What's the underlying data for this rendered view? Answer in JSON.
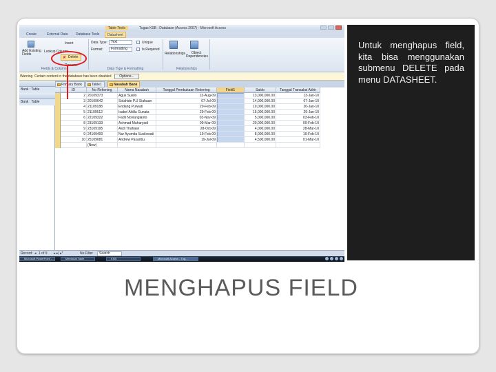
{
  "window": {
    "title": "Tugas KSB : Database (Access 2007) - Microsoft Access",
    "contextual_tab": "Table Tools"
  },
  "ribbon": {
    "tabs": [
      "Create",
      "External Data",
      "Database Tools",
      "Datasheet"
    ],
    "active_tab": "Datasheet",
    "buttons": {
      "add_existing": "Add Existing Fields",
      "lookup_column": "Lookup Column",
      "insert": "Insert",
      "delete": "Delete",
      "rename": "Rename",
      "data_type_label": "Data Type:",
      "data_type_value": "Text",
      "format_label": "Format:",
      "format_value": "Formatting",
      "unique": "Unique",
      "is_required": "Is Required",
      "relationships": "Relationships",
      "object_dependencies": "Object Dependencies"
    },
    "groups": [
      "Fields & Columns",
      "Data Type & Formatting",
      "Relationships"
    ]
  },
  "message_bar": {
    "label": "Warning",
    "text": "Certain content in the database has been disabled",
    "options_button": "Options..."
  },
  "nav_pane": {
    "items": [
      "Bank : Table",
      "Bank : Table"
    ]
  },
  "doc_tabs": [
    "Primary Bank",
    "Table1",
    "Nasabah Bank"
  ],
  "active_doc_tab": "Nasabah Bank",
  "table": {
    "columns": [
      "ID",
      "No Rekening",
      "Nama Nasabah",
      "Tanggal Pembukaan Rekening",
      "Field1",
      "Saldo",
      "Tanggal Transaksi Akhir"
    ],
    "rows": [
      [
        "2",
        "20109373",
        "Agus Susilo",
        "13-Aug-09",
        "",
        "13,000,000.00",
        "13-Jan-10"
      ],
      [
        "3",
        "20109642",
        "Solahide P.U Siahaan",
        "07-Jul-09",
        "",
        "14,000,000.00",
        "07-Jan-10"
      ],
      [
        "4",
        "21109188",
        "Endang Purwati",
        "20-Feb-09",
        "",
        "10,000,000.00",
        "20-Jan-10"
      ],
      [
        "5",
        "21109512",
        "Isabel Aldila Gunata",
        "29-Feb-09",
        "",
        "15,000,000.00",
        "29-Jan-10"
      ],
      [
        "6",
        "22109322",
        "Fadli Noviangianto",
        "03-Nov-09",
        "",
        "5,000,000.00",
        "03-Feb-10"
      ],
      [
        "8",
        "23109133",
        "Achmad Muharyadi",
        "09-Mar-09",
        "",
        "20,000,000.00",
        "09-Feb-10"
      ],
      [
        "9",
        "23109195",
        "Asdi Thahawi",
        "28-Oct-09",
        "",
        "4,000,000.00",
        "28-Mar-10"
      ],
      [
        "9",
        "24109400",
        "Nur Ayumita Susilowati",
        "19-Feb-09",
        "",
        "8,000,000.00",
        "19-Feb-10"
      ],
      [
        "10",
        "25109081",
        "Andrew Pasaribu",
        "19-Jul-09",
        "",
        "4,500,000.00",
        "01-Mar-10"
      ]
    ],
    "new_row": "(New)"
  },
  "status_bar": {
    "record_label": "Record:",
    "record_pos": "1 of 9",
    "filter": "No Filter",
    "search": "Search"
  },
  "taskbar": {
    "items": [
      "Microsoft PowerPoint - ...",
      "Membuat Table",
      "KSB",
      "Microsoft Access - Tug..."
    ]
  },
  "slide": {
    "description": "Untuk menghapus field, kita bisa menggunakan submenu DELETE pada menu DATASHEET.",
    "title": "MENGHAPUS FIELD"
  },
  "colors": {
    "dark_panel": "#1e1e1e",
    "highlight_red": "#e01b1b",
    "active_tab": "#fbe3a3"
  }
}
